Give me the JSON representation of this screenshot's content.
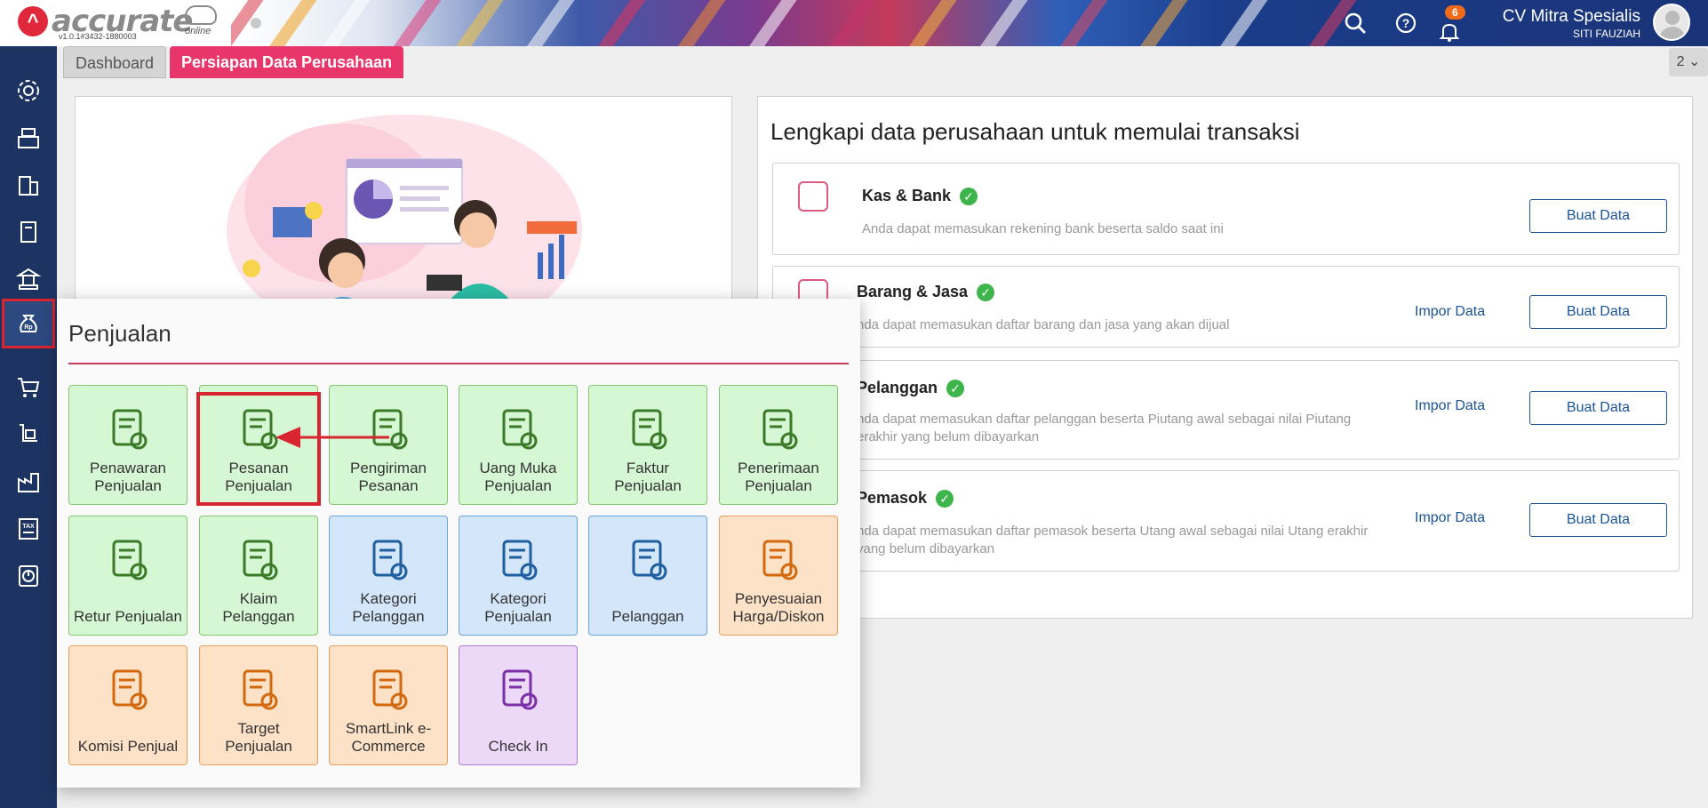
{
  "header": {
    "logo_text": "accurate",
    "logo_sub": "online",
    "version": "v1.0.1#3432-1880003",
    "notifications_count": "6",
    "company_name": "CV Mitra Spesialis",
    "user_name": "SITI FAUZIAH"
  },
  "tabs": [
    {
      "label": "Dashboard"
    },
    {
      "label": "Persiapan Data Perusahaan"
    }
  ],
  "tab_count": "2",
  "right_panel": {
    "title": "Lengkapi data perusahaan untuk memulai transaksi",
    "items": [
      {
        "name": "Kas & Bank",
        "desc": "Anda dapat memasukan rekening bank beserta saldo saat ini",
        "import": "",
        "button": "Buat Data"
      },
      {
        "name": "Barang & Jasa",
        "desc": "nda dapat memasukan daftar barang dan jasa yang akan dijual",
        "import": "Impor Data",
        "button": "Buat Data"
      },
      {
        "name": "Pelanggan",
        "desc": "nda dapat memasukan daftar pelanggan beserta Piutang awal sebagai nilai Piutang erakhir yang belum dibayarkan",
        "import": "Impor Data",
        "button": "Buat Data"
      },
      {
        "name": "Pemasok",
        "desc": "nda dapat memasukan daftar pemasok beserta Utang awal sebagai nilai Utang erakhir yang belum dibayarkan",
        "import": "Impor Data",
        "button": "Buat Data"
      }
    ]
  },
  "popup": {
    "title": "Penjualan",
    "tiles": [
      {
        "label": "Penawaran Penjualan",
        "icon": "quote-hand-icon",
        "color": "green"
      },
      {
        "label": "Pesanan Penjualan",
        "icon": "sales-order-icon",
        "color": "green"
      },
      {
        "label": "Pengiriman Pesanan",
        "icon": "delivery-truck-icon",
        "color": "green"
      },
      {
        "label": "Uang Muka Penjualan",
        "icon": "cash-icon",
        "color": "green"
      },
      {
        "label": "Faktur Penjualan",
        "icon": "invoice-icon",
        "color": "green"
      },
      {
        "label": "Penerimaan Penjualan",
        "icon": "receipt-hand-icon",
        "color": "green"
      },
      {
        "label": "Retur Penjualan",
        "icon": "return-box-icon",
        "color": "green"
      },
      {
        "label": "Klaim Pelanggan",
        "icon": "claim-user-icon",
        "color": "green"
      },
      {
        "label": "Kategori Pelanggan",
        "icon": "customer-category-icon",
        "color": "blue"
      },
      {
        "label": "Kategori Penjualan",
        "icon": "tag-icon",
        "color": "blue"
      },
      {
        "label": "Pelanggan",
        "icon": "customer-basket-icon",
        "color": "blue"
      },
      {
        "label": "Penyesuaian Harga/Diskon",
        "icon": "price-adjust-icon",
        "color": "orange"
      },
      {
        "label": "Komisi Penjual",
        "icon": "commission-icon",
        "color": "orange"
      },
      {
        "label": "Target Penjualan",
        "icon": "target-chart-icon",
        "color": "orange"
      },
      {
        "label": "SmartLink e-Commerce",
        "icon": "store-icon",
        "color": "orange"
      },
      {
        "label": "Check In",
        "icon": "check-in-icon",
        "color": "purple"
      }
    ]
  }
}
